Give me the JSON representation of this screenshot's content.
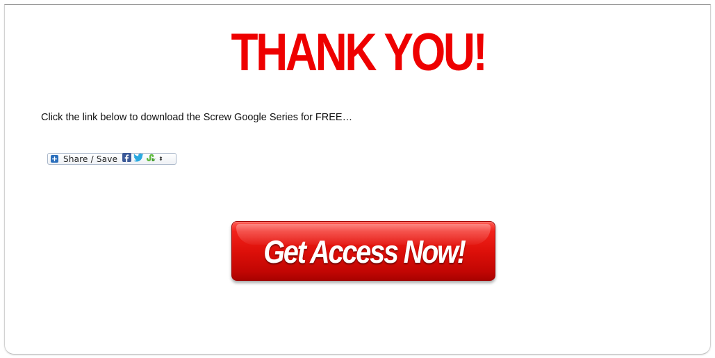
{
  "colors": {
    "heading": "#ee0000",
    "body_text": "#111111",
    "button_red": "#dc0f09",
    "button_text": "#ffffff",
    "share_plus": "#2a6ebb",
    "facebook": "#3b5998",
    "twitter": "#2aa9e0",
    "stumble": "#5bb83a"
  },
  "heading": {
    "text": "THANK YOU!"
  },
  "intro": {
    "text": "Click the link below to download the Screw Google Series for FREE…"
  },
  "share_widget": {
    "label": "Share / Save",
    "plus_glyph": "+",
    "services": [
      "facebook-icon",
      "twitter-icon",
      "stumbleupon-icon"
    ],
    "caret_glyph": "⬍"
  },
  "cta": {
    "label": "Get Access Now!"
  }
}
